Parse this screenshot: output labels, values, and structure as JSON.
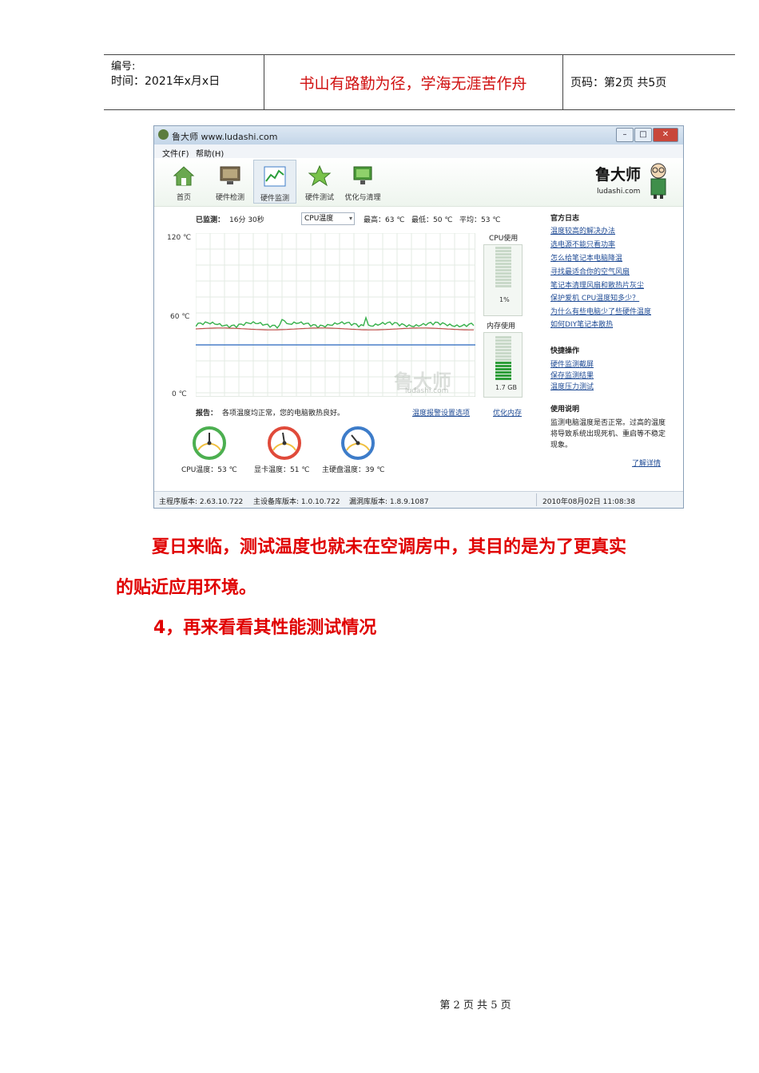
{
  "header": {
    "number_label": "编号:",
    "time_label": "时间：2021年x月x日",
    "motto": "书山有路勤为径，学海无涯苦作舟",
    "page_info": "页码：第2页  共5页"
  },
  "window": {
    "title": "鲁大师 www.ludashi.com",
    "menu": [
      "文件(F)",
      "帮助(H)"
    ],
    "toolbar": [
      "首页",
      "硬件检测",
      "硬件监测",
      "硬件测试",
      "优化与清理"
    ],
    "brand_name": "鲁大师",
    "brand_url": "ludashi.com",
    "monitor": {
      "elapsed_label": "已监测：",
      "elapsed_value": "16分 30秒",
      "selector": "CPU温度",
      "max": "最高：63 ℃",
      "min": "最低：50 ℃",
      "avg": "平均：53 ℃"
    },
    "y_labels": [
      "120 ℃",
      "60 ℃",
      "0 ℃"
    ],
    "cpu_usage": {
      "label": "CPU使用",
      "value": "1%",
      "level": 0.01
    },
    "mem_usage": {
      "label": "内存使用",
      "value": "1.7 GB",
      "level": 0.4
    },
    "watermark": "鲁大师",
    "watermark_url": "ludashi.com",
    "report": {
      "label": "报告：",
      "text": "各项温度均正常，您的电脑散热良好。",
      "link1": "温度报警设置选项",
      "link2": "优化内存"
    },
    "gauges": [
      {
        "label": "CPU温度：53 ℃",
        "color": "#4caf50"
      },
      {
        "label": "显卡温度：51 ℃",
        "color": "#e04a3a"
      },
      {
        "label": "主硬盘温度：39 ℃",
        "color": "#3d7cc9"
      }
    ],
    "official_log": {
      "title": "官方日志",
      "links": [
        "温度较高的解决办法",
        "选电源不能只看功率",
        "怎么给笔记本电脑降温",
        "寻找最适合你的空气风扇",
        "笔记本清理风扇和散热片灰尘",
        "保护爱机 CPU温度知多少？",
        "为什么有些电脑少了些硬件温度",
        "如何DIY笔记本散热"
      ]
    },
    "quick_ops": {
      "title": "快捷操作",
      "links": [
        "硬件监测截屏",
        "保存监测结果",
        "温度压力测试"
      ]
    },
    "usage_note": {
      "title": "使用说明",
      "text": "监测电脑温度是否正常。过高的温度将导致系统出现死机、重启等不稳定现象。",
      "more": "了解详情"
    },
    "status": {
      "main_version": "主程序版本: 2.63.10.722",
      "device_db": "主设备库版本: 1.0.10.722",
      "vuln_db": "漏洞库版本: 1.8.9.1087",
      "datetime": "2010年08月02日 11:08:38"
    }
  },
  "body": {
    "para1_line1": "夏日来临，测试温度也就未在空调房中，其目的是为了更真实",
    "para1_line2": "的贴近应用环境。",
    "para2": "4，再来看看其性能测试情况"
  },
  "footer": "第 2 页 共 5 页"
}
